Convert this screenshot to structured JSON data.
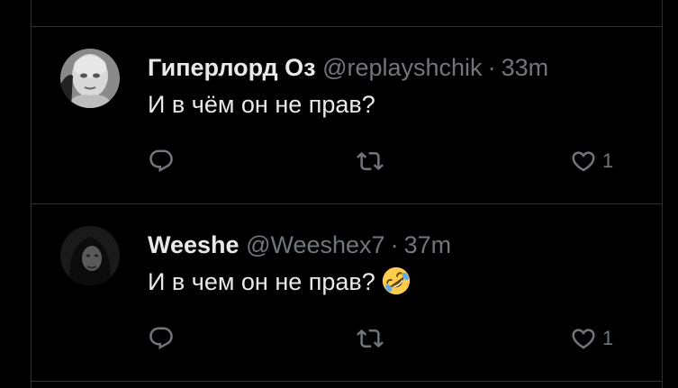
{
  "tweets": [
    {
      "name": "Гиперлорд Оз",
      "handle": "@replayshchik",
      "separator": "·",
      "time": "33m",
      "text": "И в чём он не прав?",
      "avatar": "bald-person-avatar",
      "likes": "1"
    },
    {
      "name": "Weeshe",
      "handle": "@Weeshex7",
      "separator": "·",
      "time": "37m",
      "text": "И в чем он не прав?",
      "emoji": "rolling-on-floor-laughing-emoji",
      "avatar": "hooded-person-avatar",
      "likes": "1"
    }
  ],
  "colors": {
    "background": "#000000",
    "text": "#e7e9ea",
    "muted": "#71767b",
    "divider": "#2f3336"
  }
}
